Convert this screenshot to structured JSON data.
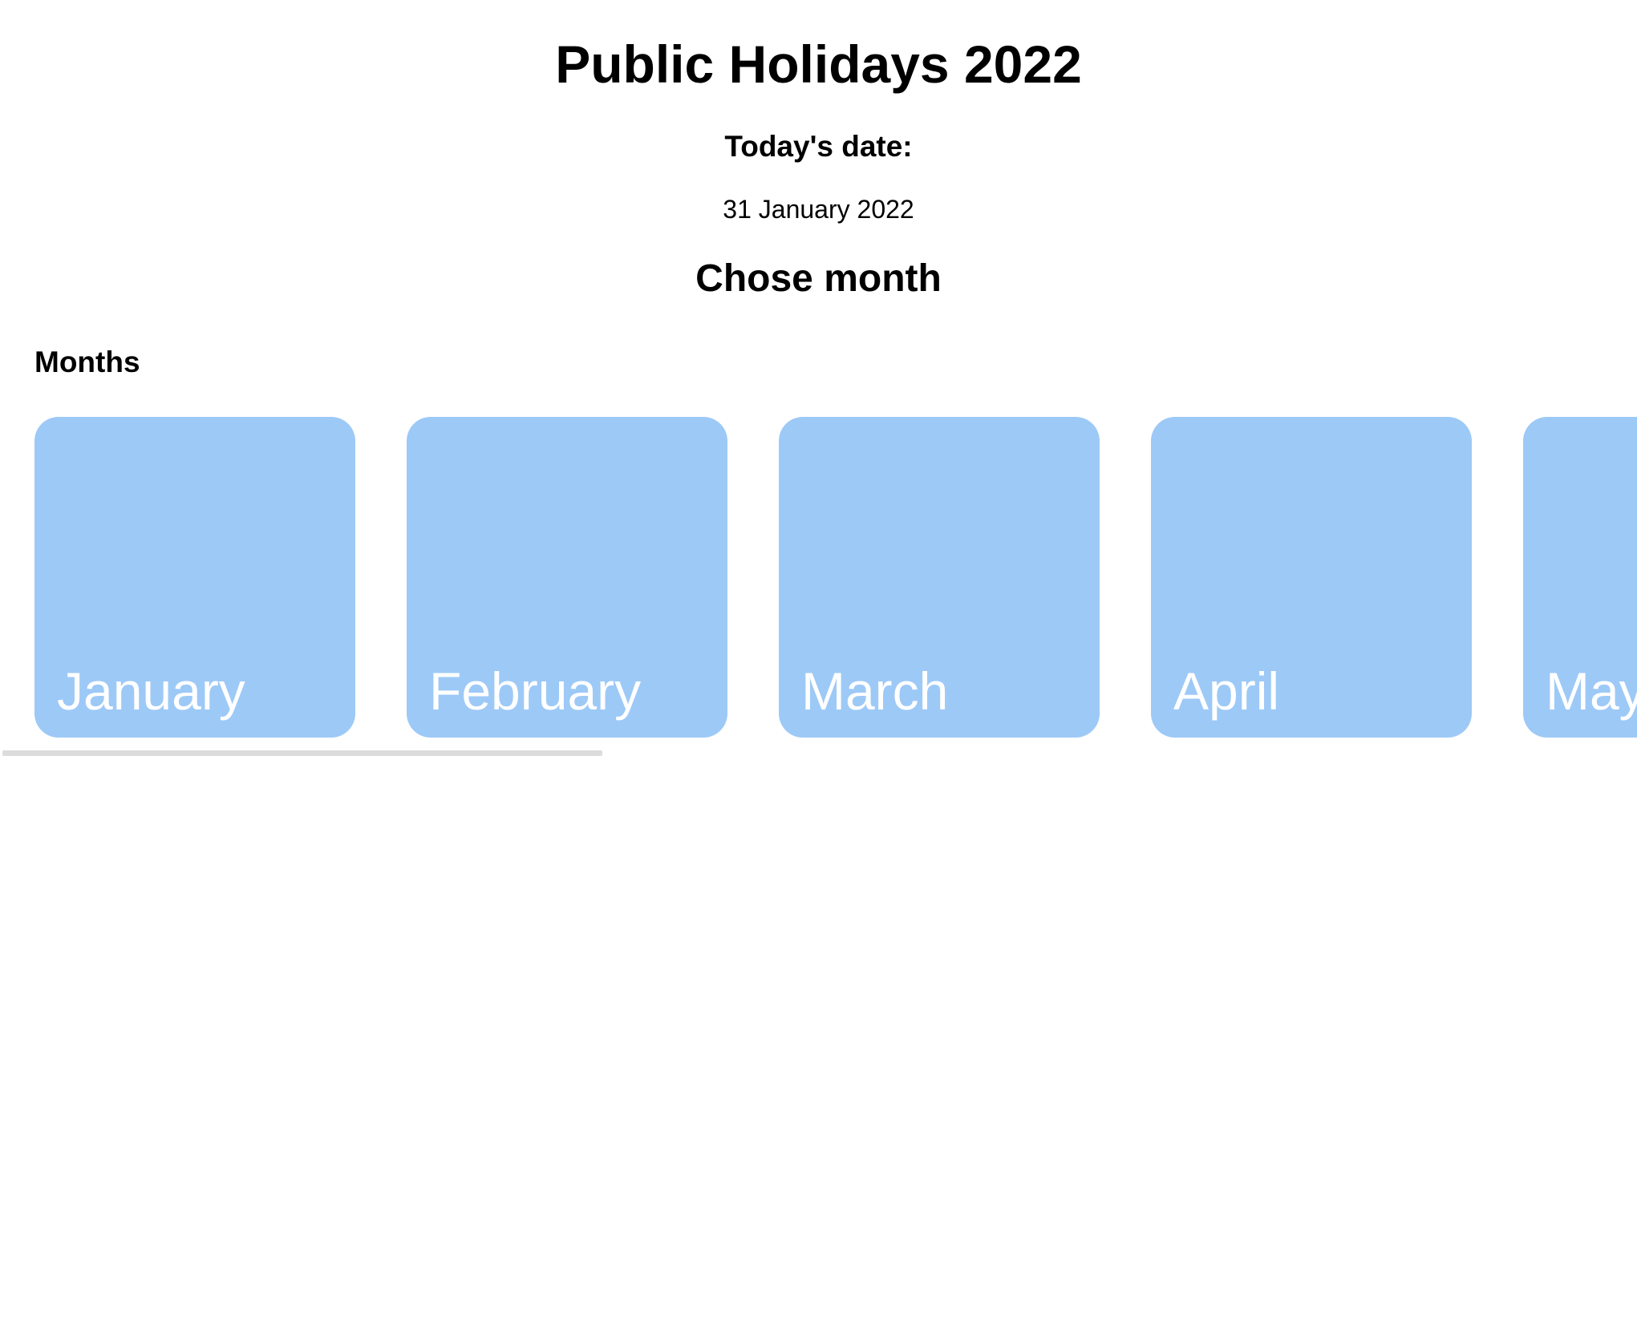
{
  "header": {
    "title": "Public Holidays 2022",
    "today_label": "Today's date:",
    "today_value": "31 January 2022",
    "choose_heading": "Chose month"
  },
  "months_section": {
    "label": "Months",
    "cards": [
      {
        "name": "January"
      },
      {
        "name": "February"
      },
      {
        "name": "March"
      },
      {
        "name": "April"
      },
      {
        "name": "May"
      }
    ]
  },
  "colors": {
    "card_background": "#9dc9f7",
    "card_text": "#ffffff",
    "scrollbar_thumb": "#dcdcdc"
  }
}
